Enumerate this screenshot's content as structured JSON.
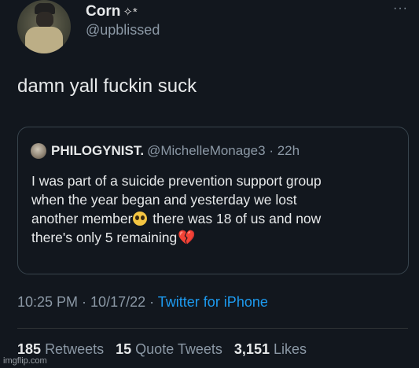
{
  "author": {
    "name": "Corn",
    "name_suffix": "✧*",
    "handle": "@upblissed"
  },
  "more_label": "···",
  "tweet_text": "damn yall fuckin suck",
  "quote": {
    "name": "PHILOGYNIST.",
    "handle": "@MichelleMonage3",
    "time_sep": " · ",
    "time": "22h",
    "line1": "I was part of a suicide prevention support group",
    "line2": "when the year began and yesterday we lost",
    "line3a": "another member",
    "line3b": " there was 18 of us and now",
    "line4": "there's only 5 remaining",
    "emoji_1": "pleading-face-emoji",
    "emoji_2": "broken-heart-emoji"
  },
  "meta": {
    "time": "10:25 PM",
    "sep1": " · ",
    "date": "10/17/22",
    "sep2": " · ",
    "source": "Twitter for iPhone"
  },
  "stats": {
    "retweets_count": "185",
    "retweets_label": "Retweets",
    "quotes_count": "15",
    "quotes_label": "Quote Tweets",
    "likes_count": "3,151",
    "likes_label": "Likes"
  },
  "watermark": "imgflip.com",
  "colors": {
    "background": "#12171e",
    "text": "#e7e9ea",
    "secondary": "#8b98a5",
    "link": "#1d9bf0",
    "border": "#38444d"
  }
}
